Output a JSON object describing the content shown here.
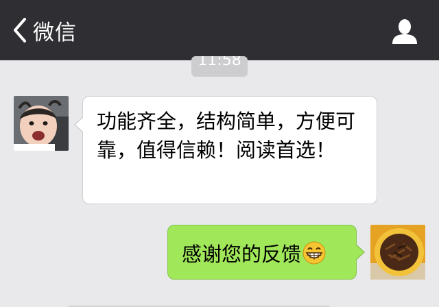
{
  "nav": {
    "back_label": "微信",
    "back_icon": "chevron-left-icon",
    "profile_icon": "person-icon"
  },
  "timestamp": "11:58",
  "messages": [
    {
      "direction": "incoming",
      "avatar": "child-avatar",
      "text": "功能齐全，结构简单，方便可靠，值得信赖！阅读首选！"
    },
    {
      "direction": "outgoing",
      "avatar": "food-bowl-avatar",
      "text": "感谢您的反馈",
      "emoji": "grinning-face-emoji"
    }
  ],
  "colors": {
    "nav_background": "#2f2f33",
    "chat_background": "#e9e9ec",
    "incoming_bubble": "#ffffff",
    "outgoing_bubble": "#a0e75a"
  }
}
